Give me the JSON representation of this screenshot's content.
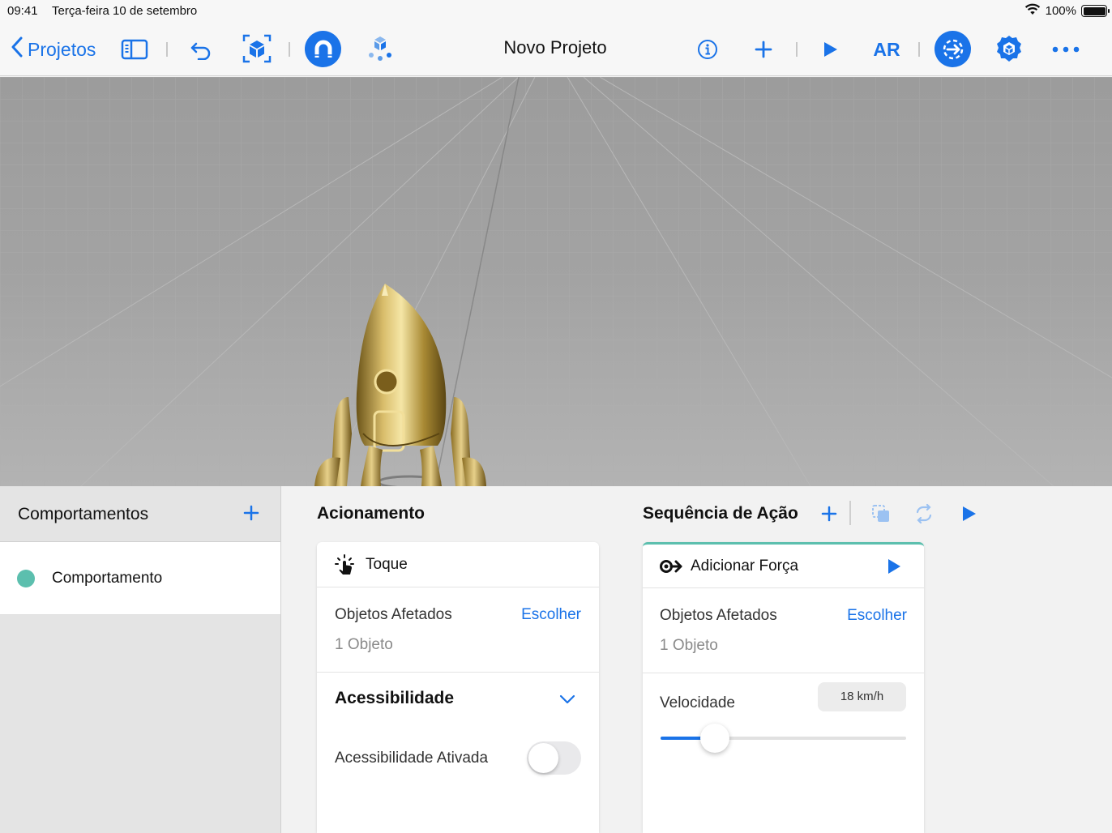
{
  "status_bar": {
    "time": "09:41",
    "date": "Terça-feira 10 de setembro",
    "battery": "100%",
    "battery_level": 1.0
  },
  "toolbar": {
    "back_label": "Projetos",
    "title": "Novo Projeto",
    "ar_label": "AR",
    "icons": [
      "sidebar-toggle-icon",
      "undo-icon",
      "scene-cube-icon",
      "snap-magnet-icon",
      "anchor-blocks-icon",
      "info-icon",
      "plus-icon",
      "play-icon",
      "behaviors-icon",
      "settings-gear-icon",
      "more-icon"
    ],
    "accent_color": "#1a73e8"
  },
  "sidebar": {
    "title": "Comportamentos",
    "items": [
      {
        "label": "Comportamento",
        "color": "#5cbfae"
      }
    ]
  },
  "trigger": {
    "section_title": "Acionamento",
    "card_title": "Toque",
    "affected_label": "Objetos Afetados",
    "choose_label": "Escolher",
    "affected_count": "1 Objeto",
    "accessibility_title": "Acessibilidade",
    "accessibility_toggle_label": "Acessibilidade Ativada",
    "accessibility_enabled": false
  },
  "action_sequence": {
    "section_title": "Sequência de Ação",
    "card_title": "Adicionar Força",
    "affected_label": "Objetos Afetados",
    "choose_label": "Escolher",
    "affected_count": "1 Objeto",
    "speed_label": "Velocidade",
    "speed_value": "18 km/h",
    "speed_fraction": 0.22
  }
}
